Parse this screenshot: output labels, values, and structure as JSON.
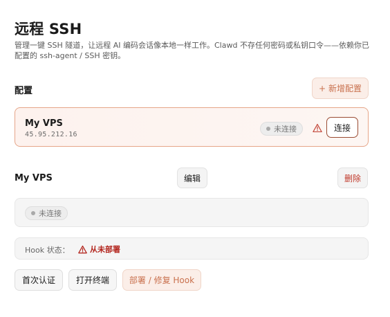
{
  "header": {
    "title": "远程 SSH",
    "description": "管理一键 SSH 隧道，让远程 AI 编码会话像本地一样工作。Clawd 不存任何密码或私钥口令——依赖你已配置的 ssh-agent / SSH 密钥。"
  },
  "configs": {
    "section_label": "配置",
    "add_button": "新增配置",
    "add_icon": "+",
    "items": [
      {
        "name": "My VPS",
        "host": "45.95.212.16",
        "status": "未连接",
        "warning_icon": "warning-triangle-icon",
        "connect_label": "连接"
      }
    ]
  },
  "detail": {
    "title": "My VPS",
    "edit_label": "编辑",
    "delete_label": "删除",
    "connection_status": "未连接",
    "hook_label": "Hook 状态：",
    "hook_status": "从未部署",
    "actions": {
      "first_auth": "首次认证",
      "open_terminal": "打开终端",
      "deploy_hook": "部署 / 修复 Hook"
    }
  },
  "colors": {
    "accent": "#c9714e",
    "accent_bg": "#fbeee8",
    "danger": "#b3261e",
    "card_border": "#e6a588"
  }
}
